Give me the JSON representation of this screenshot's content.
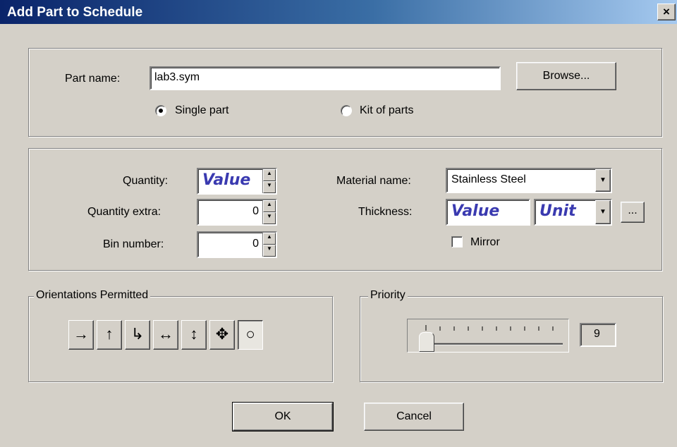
{
  "window": {
    "title": "Add Part to Schedule",
    "close_glyph": "×"
  },
  "part": {
    "label": "Part name:",
    "value": "lab3.sym",
    "browse_label": "Browse...",
    "single_label": "Single part",
    "kit_label": "Kit of parts",
    "selected": "single"
  },
  "details": {
    "quantity_label": "Quantity:",
    "quantity_value": "Value",
    "quantity_extra_label": "Quantity extra:",
    "quantity_extra_value": "0",
    "bin_label": "Bin number:",
    "bin_value": "0",
    "material_label": "Material name:",
    "material_value": "Stainless Steel",
    "thickness_label": "Thickness:",
    "thickness_value": "Value",
    "thickness_unit": "Unit",
    "ellipsis": "...",
    "mirror_label": "Mirror",
    "mirror_checked": false
  },
  "orientations": {
    "title": "Orientations Permitted",
    "buttons": [
      {
        "icon": "arrow-right-icon",
        "glyph": "→",
        "pressed": false
      },
      {
        "icon": "arrow-up-icon",
        "glyph": "↑",
        "pressed": false
      },
      {
        "icon": "corner-arrow-icon",
        "glyph": "↳",
        "pressed": false
      },
      {
        "icon": "arrow-left-right-icon",
        "glyph": "↔",
        "pressed": false
      },
      {
        "icon": "arrow-up-down-icon",
        "glyph": "↕",
        "pressed": false
      },
      {
        "icon": "move-cross-icon",
        "glyph": "✥",
        "pressed": false
      },
      {
        "icon": "circle-icon",
        "glyph": "○",
        "pressed": true
      }
    ]
  },
  "priority": {
    "title": "Priority",
    "value": "9",
    "slider_level": 0
  },
  "footer": {
    "ok_label": "OK",
    "cancel_label": "Cancel"
  }
}
